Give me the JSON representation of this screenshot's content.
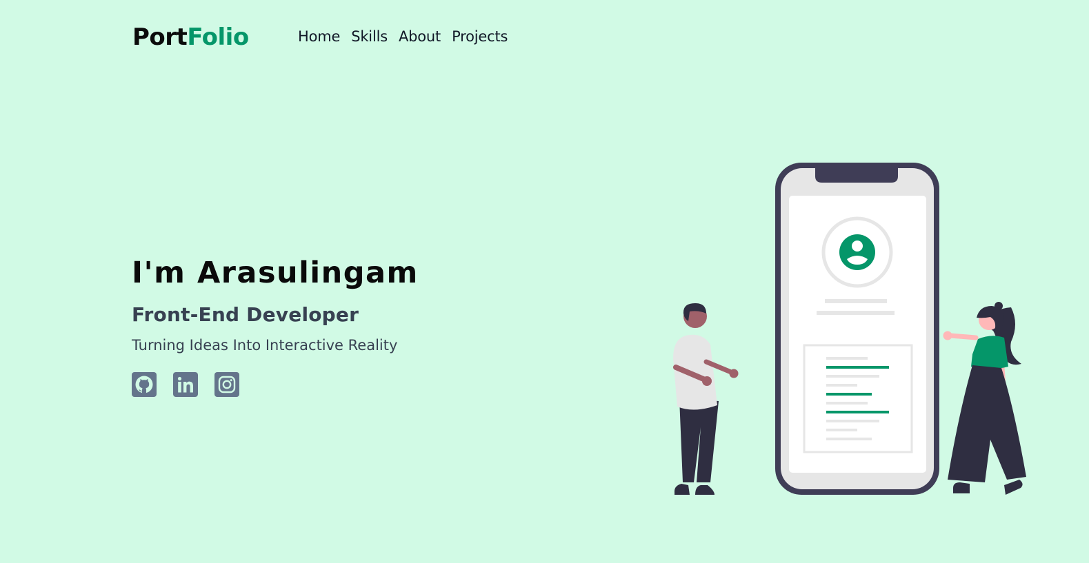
{
  "logo": {
    "part1": "Port",
    "part2": "Folio",
    "accent_color": "#059669"
  },
  "nav": {
    "items": [
      {
        "label": "Home"
      },
      {
        "label": "Skills"
      },
      {
        "label": "About"
      },
      {
        "label": "Projects"
      }
    ]
  },
  "hero": {
    "title": "I'm Arasulingam",
    "role": "Front-End Developer",
    "tagline": "Turning Ideas Into Interactive Reality"
  },
  "socials": [
    {
      "icon": "github-icon"
    },
    {
      "icon": "linkedin-icon"
    },
    {
      "icon": "instagram-icon"
    }
  ],
  "colors": {
    "background": "#d1fae5",
    "accent": "#059669",
    "icon": "#64748b",
    "phone_frame": "#3f3d56"
  }
}
